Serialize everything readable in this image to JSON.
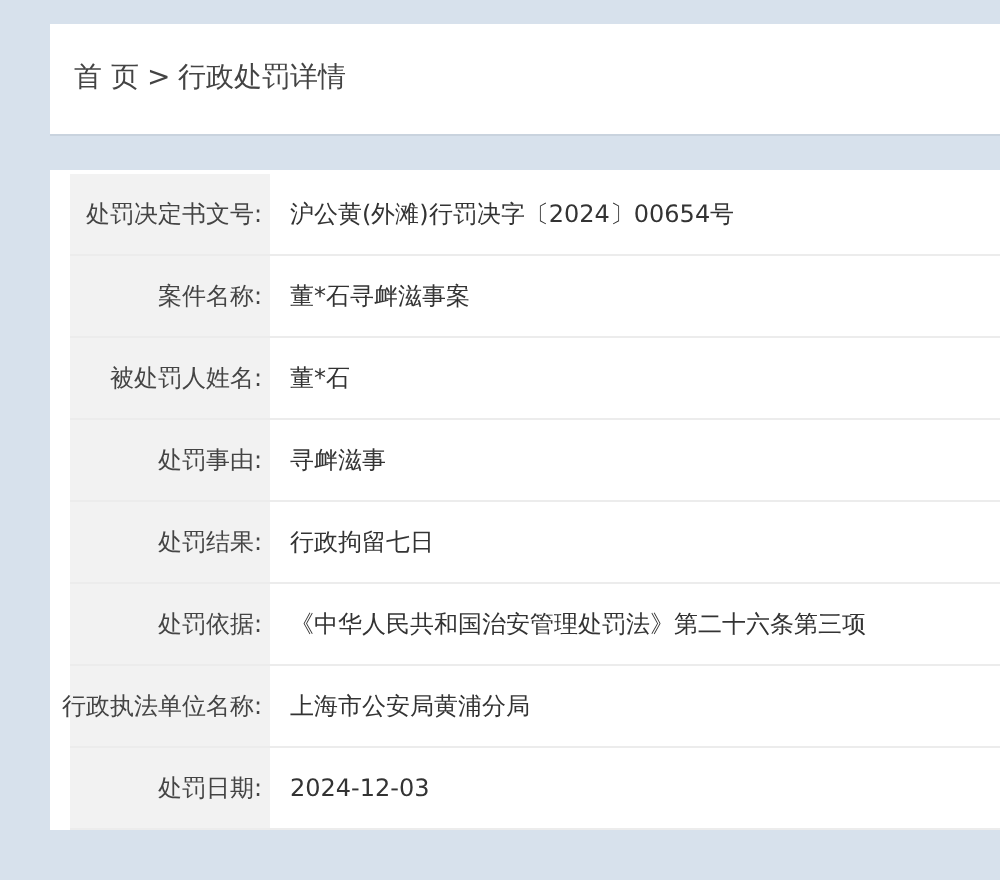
{
  "breadcrumb": [
    {
      "label": "首 页"
    },
    {
      "label": "行政处罚详情"
    }
  ],
  "separator": ">",
  "details": [
    {
      "label": "处罚决定书文号:",
      "value": "沪公黄(外滩)行罚决字〔2024〕00654号"
    },
    {
      "label": "案件名称:",
      "value": "董*石寻衅滋事案"
    },
    {
      "label": "被处罚人姓名:",
      "value": "董*石"
    },
    {
      "label": "处罚事由:",
      "value": "寻衅滋事"
    },
    {
      "label": "处罚结果:",
      "value": "行政拘留七日"
    },
    {
      "label": "处罚依据:",
      "value": "《中华人民共和国治安管理处罚法》第二十六条第三项"
    },
    {
      "label": "行政执法单位名称:",
      "value": "上海市公安局黄浦分局"
    },
    {
      "label": "处罚日期:",
      "value": "2024-12-03"
    }
  ]
}
